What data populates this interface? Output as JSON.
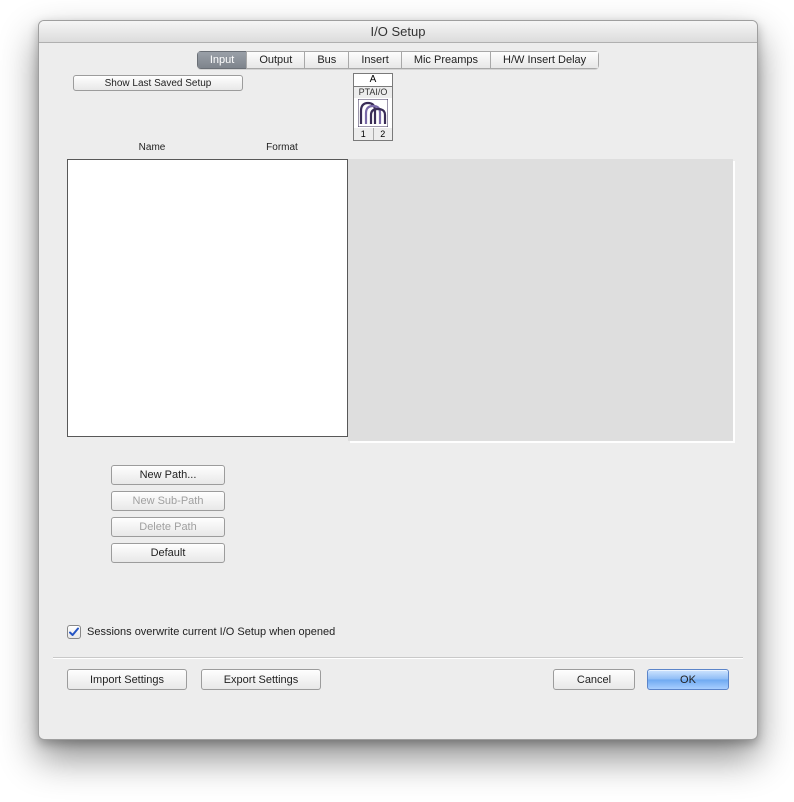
{
  "window": {
    "title": "I/O Setup"
  },
  "tabs": {
    "input": "Input",
    "output": "Output",
    "bus": "Bus",
    "insert": "Insert",
    "mic_preamps": "Mic Preamps",
    "hw_insert_delay": "H/W Insert Delay",
    "active": "input"
  },
  "toolbar": {
    "show_last_saved": "Show Last Saved Setup"
  },
  "columns": {
    "name": "Name",
    "format": "Format"
  },
  "io_header": {
    "slot": "A",
    "device": "PTAI/O",
    "channels": [
      "1",
      "2"
    ]
  },
  "path_buttons": {
    "new_path": "New Path...",
    "new_sub_path": "New Sub-Path",
    "delete_path": "Delete Path",
    "default": "Default"
  },
  "checkbox": {
    "sessions_overwrite": "Sessions overwrite current I/O Setup when opened",
    "checked": true
  },
  "footer": {
    "import_settings": "Import Settings",
    "export_settings": "Export Settings",
    "cancel": "Cancel",
    "ok": "OK"
  }
}
